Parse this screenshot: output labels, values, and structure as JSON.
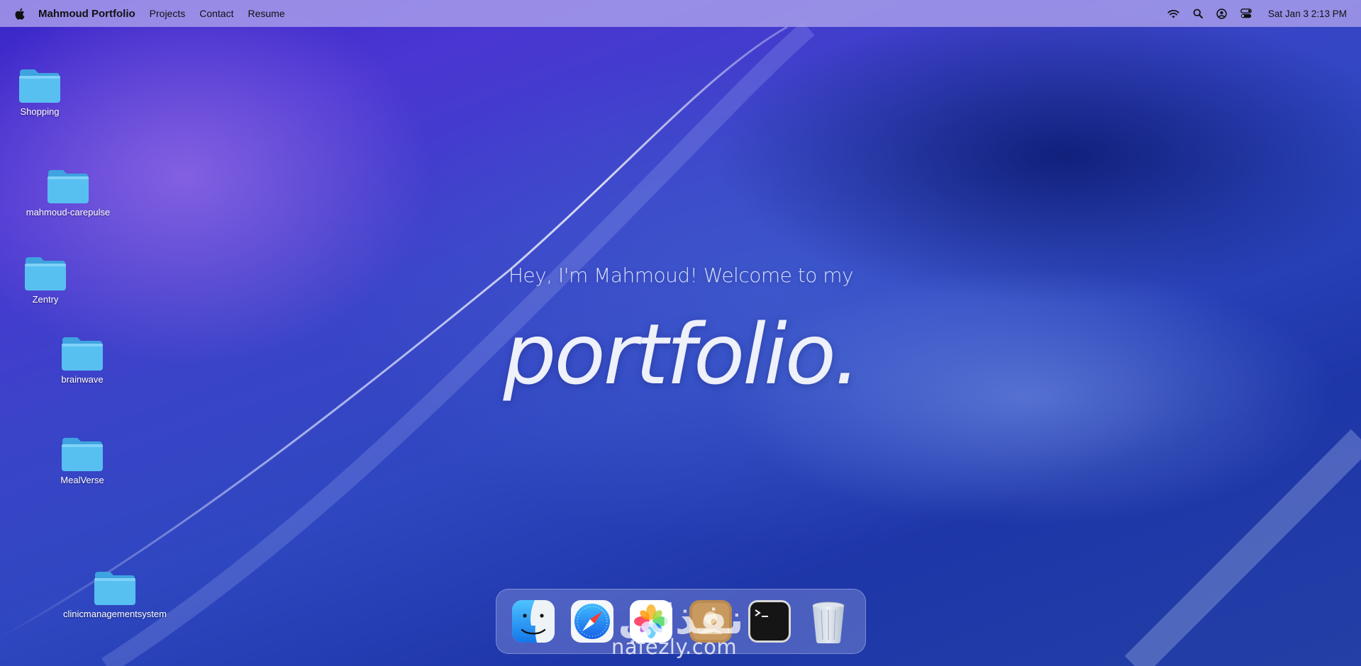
{
  "menubar": {
    "app_name": "Mahmoud Portfolio",
    "menus": [
      {
        "label": "Projects"
      },
      {
        "label": "Contact"
      },
      {
        "label": "Resume"
      }
    ],
    "status_icons": [
      "wifi-icon",
      "search-icon",
      "user-icon",
      "control-center-icon"
    ],
    "clock": "Sat Jan 3 2:13 PM"
  },
  "desktop": {
    "folders": [
      {
        "label": "Shopping"
      },
      {
        "label": "mahmoud-carepulse"
      },
      {
        "label": "Zentry"
      },
      {
        "label": "brainwave"
      },
      {
        "label": "MealVerse"
      },
      {
        "label": "clinicmanagementsystem"
      }
    ]
  },
  "hero": {
    "subtitle": "Hey, I'm Mahmoud! Welcome to my",
    "title": "portfolio."
  },
  "dock": {
    "apps": [
      "finder-icon",
      "safari-icon",
      "photos-icon",
      "contacts-icon",
      "terminal-icon",
      "trash-icon"
    ]
  },
  "watermark": {
    "text": "nafezly.com",
    "arabic": "نفذلي"
  },
  "colors": {
    "folder_blue": "#4fb6ee",
    "menubar_bg": "#aaa0eb",
    "wallpaper_primary": "#3a25c8"
  }
}
